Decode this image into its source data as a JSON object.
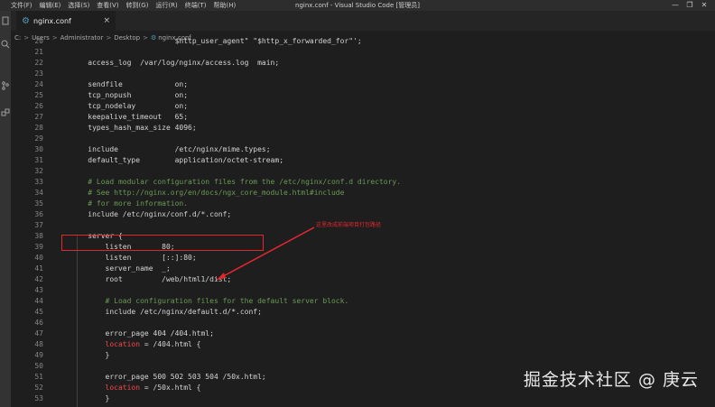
{
  "window": {
    "title": "nginx.conf - Visual Studio Code [管理员]",
    "menu": [
      "文件(F)",
      "编辑(E)",
      "选择(S)",
      "查看(V)",
      "转到(G)",
      "运行(R)",
      "终端(T)",
      "帮助(H)"
    ],
    "controls": [
      "—",
      "❐",
      "✕"
    ]
  },
  "activity_icons": [
    "files-icon",
    "search-icon",
    "source-control-icon",
    "extensions-icon"
  ],
  "tab": {
    "label": "nginx.conf",
    "close": "×"
  },
  "breadcrumb": {
    "items": [
      "C:",
      "Users",
      "Administrator",
      "Desktop",
      "nginx.conf"
    ],
    "sep": ">"
  },
  "code_lines": [
    {
      "n": "20",
      "t": "                        $http_user_agent\" \"$http_x_forwarded_for\"';",
      "c": false
    },
    {
      "n": "21",
      "t": "",
      "c": false
    },
    {
      "n": "22",
      "t": "    access_log  /var/log/nginx/access.log  main;",
      "c": false
    },
    {
      "n": "23",
      "t": "",
      "c": false
    },
    {
      "n": "24",
      "t": "    sendfile            on;",
      "c": false
    },
    {
      "n": "25",
      "t": "    tcp_nopush          on;",
      "c": false
    },
    {
      "n": "26",
      "t": "    tcp_nodelay         on;",
      "c": false
    },
    {
      "n": "27",
      "t": "    keepalive_timeout   65;",
      "c": false
    },
    {
      "n": "28",
      "t": "    types_hash_max_size 4096;",
      "c": false
    },
    {
      "n": "29",
      "t": "",
      "c": false
    },
    {
      "n": "30",
      "t": "    include             /etc/nginx/mime.types;",
      "c": false
    },
    {
      "n": "31",
      "t": "    default_type        application/octet-stream;",
      "c": false
    },
    {
      "n": "32",
      "t": "",
      "c": false
    },
    {
      "n": "33",
      "t": "    # Load modular configuration files from the /etc/nginx/conf.d directory.",
      "c": true
    },
    {
      "n": "34",
      "t": "    # See http://nginx.org/en/docs/ngx_core_module.html#include",
      "c": true
    },
    {
      "n": "35",
      "t": "    # for more information.",
      "c": true
    },
    {
      "n": "36",
      "t": "    include /etc/nginx/conf.d/*.conf;",
      "c": false
    },
    {
      "n": "37",
      "t": "",
      "c": false
    },
    {
      "n": "38",
      "t": "    server {",
      "c": false
    },
    {
      "n": "39",
      "t": "        listen       80;",
      "c": false
    },
    {
      "n": "40",
      "t": "        listen       [::]:80;",
      "c": false
    },
    {
      "n": "41",
      "t": "        server_name  _;",
      "c": false
    },
    {
      "n": "42",
      "t": "        root         /web/html1/dist;",
      "c": false
    },
    {
      "n": "43",
      "t": "",
      "c": false
    },
    {
      "n": "44",
      "t": "        # Load configuration files for the default server block.",
      "c": true
    },
    {
      "n": "45",
      "t": "        include /etc/nginx/default.d/*.conf;",
      "c": false
    },
    {
      "n": "46",
      "t": "",
      "c": false
    },
    {
      "n": "47",
      "t": "        error_page 404 /404.html;",
      "c": false
    },
    {
      "n": "48",
      "t": "        location = /404.html {",
      "c": false,
      "kw": "location"
    },
    {
      "n": "49",
      "t": "        }",
      "c": false
    },
    {
      "n": "50",
      "t": "",
      "c": false
    },
    {
      "n": "51",
      "t": "        error_page 500 502 503 504 /50x.html;",
      "c": false
    },
    {
      "n": "52",
      "t": "        location = /50x.html {",
      "c": false,
      "kw": "location"
    },
    {
      "n": "53",
      "t": "        }",
      "c": false
    }
  ],
  "annotation": {
    "text": "这里改成前端项目打包路径",
    "color": "#e2282f"
  },
  "watermark": "掘金技术社区 @ 庚云",
  "colors": {
    "background": "#1e1e1e",
    "comment": "#6a9955",
    "highlight": "#e2282f",
    "keyword": "#f44747"
  }
}
